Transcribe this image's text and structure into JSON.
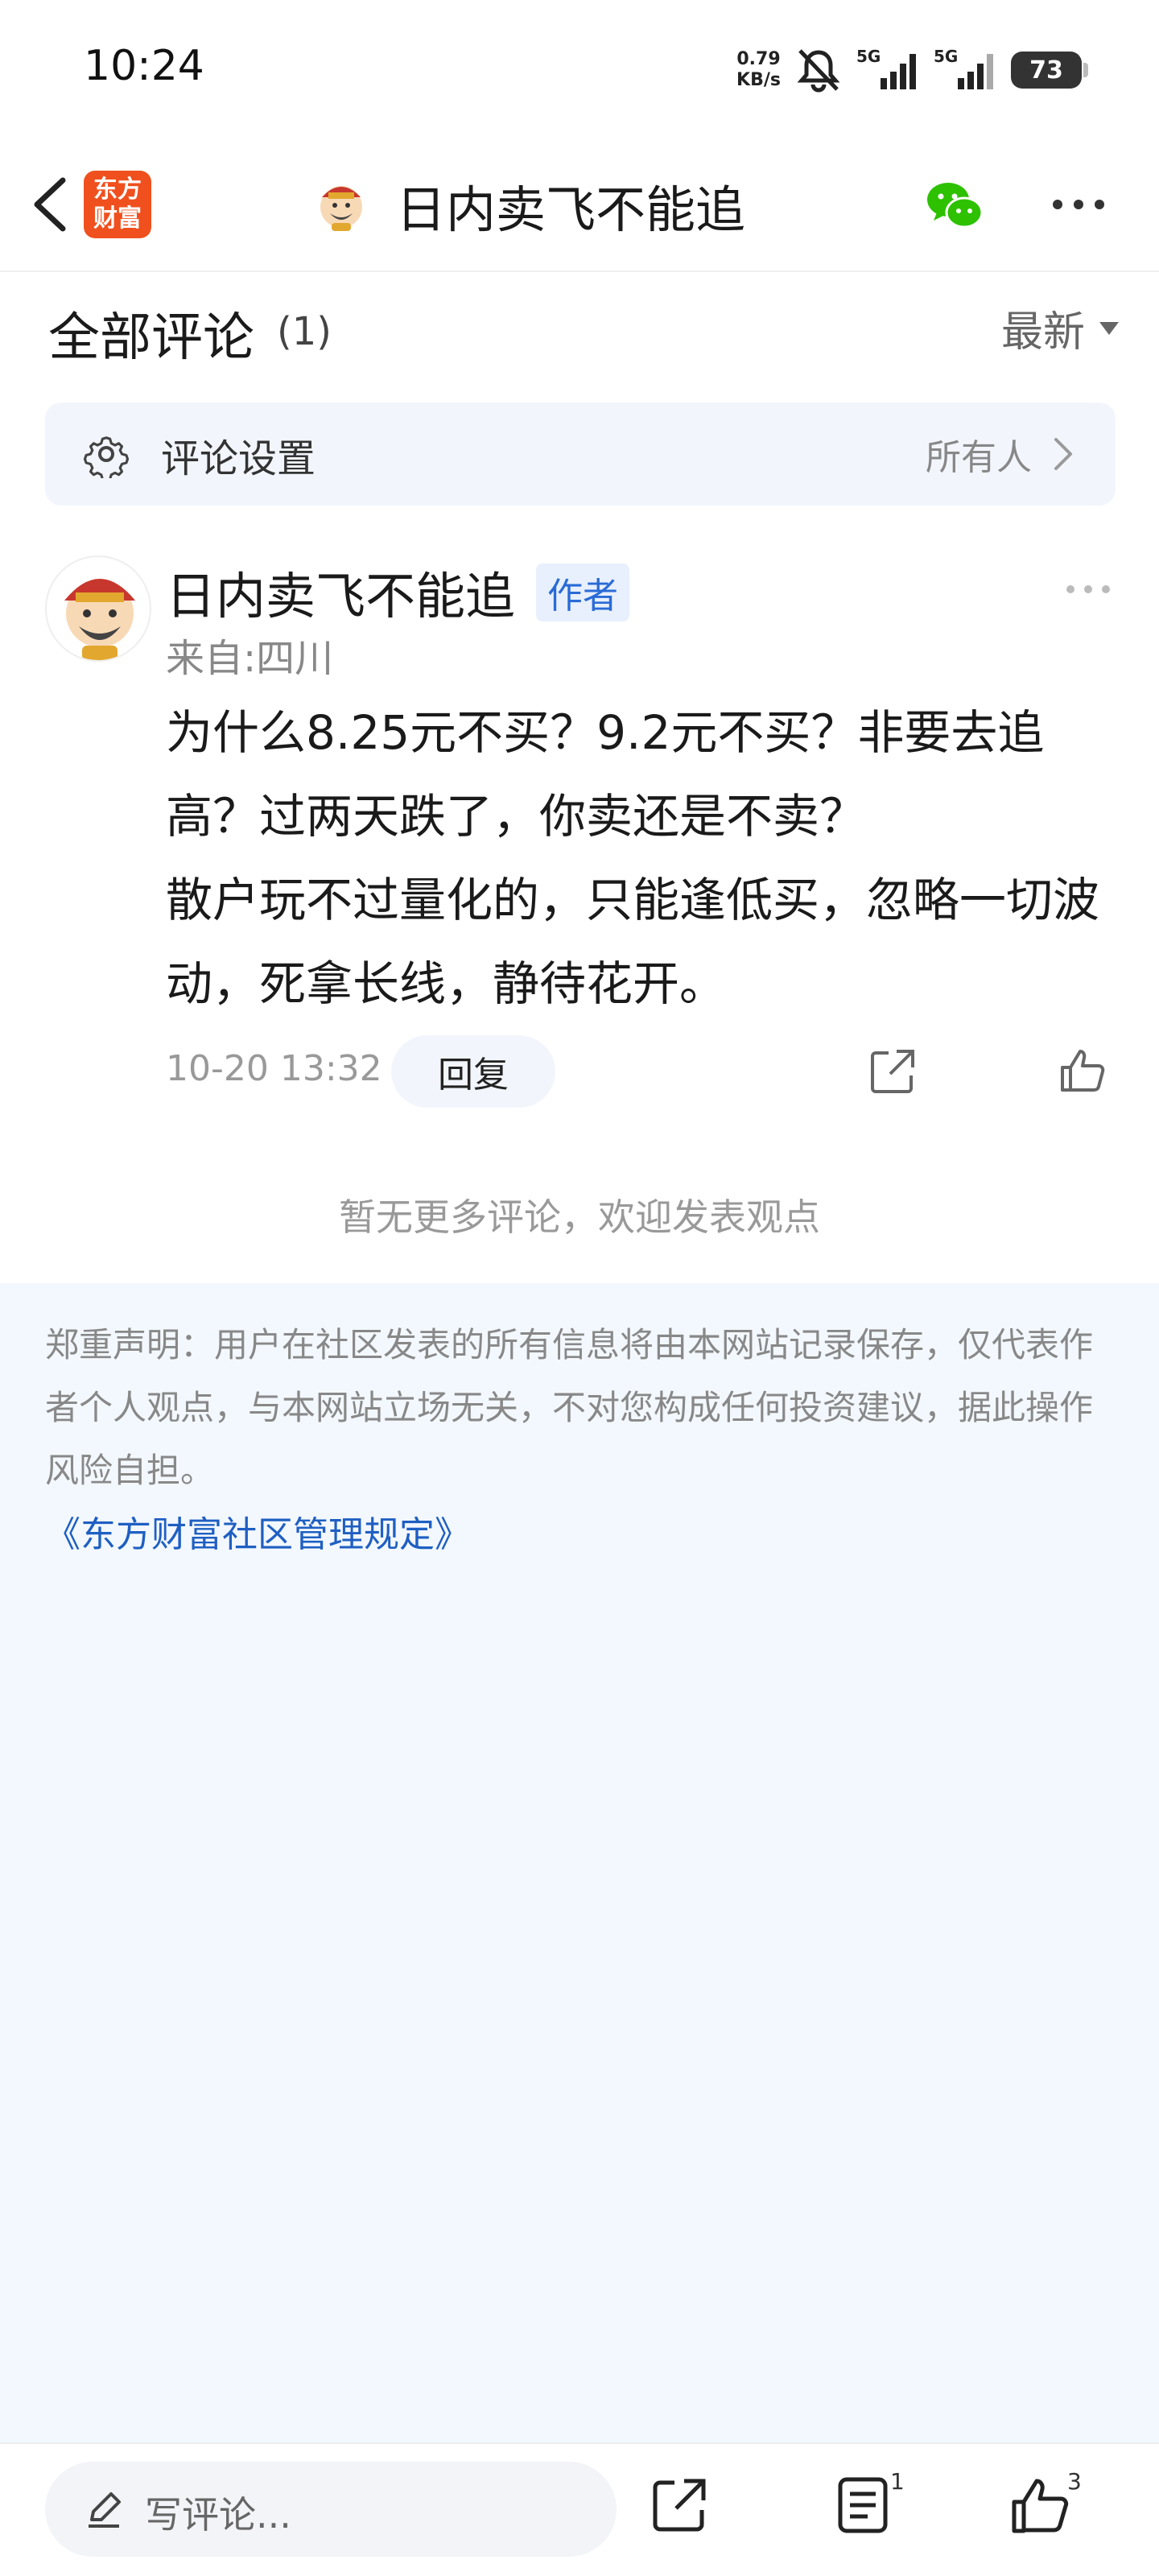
{
  "status_bar": {
    "time": "10:24",
    "net_speed_value": "0.79",
    "net_speed_unit": "KB/s",
    "signal_1": "5G",
    "signal_2": "5G",
    "battery": "73"
  },
  "nav": {
    "logo_line1": "东方",
    "logo_line2": "财富",
    "title": "日内卖飞不能追"
  },
  "comments": {
    "title": "全部评论",
    "count": "(1)",
    "sort": "最新"
  },
  "settings": {
    "label": "评论设置",
    "value": "所有人"
  },
  "comment": {
    "author": "日内卖飞不能追",
    "tag": "作者",
    "from": "来自:四川",
    "body_line1": "为什么8.25元不买？9.2元不买？非要去追高？过两天跌了，你卖还是不卖？",
    "body_line2": "散户玩不过量化的，只能逢低买，忽略一切波动，死拿长线，静待花开。",
    "time": "10-20 13:32",
    "reply": "回复"
  },
  "no_more": "暂无更多评论，欢迎发表观点",
  "disclaimer": {
    "text": "郑重声明：用户在社区发表的所有信息将由本网站记录保存，仅代表作者个人观点，与本网站立场无关，不对您构成任何投资建议，据此操作风险自担。",
    "link": "《东方财富社区管理规定》"
  },
  "bottom_bar": {
    "placeholder": "写评论...",
    "list_badge": "1",
    "like_badge": "3"
  },
  "colors": {
    "brand_orange": "#f0501e",
    "link_blue": "#1f5fc2",
    "tag_blue": "#2a6bd6",
    "wechat_green": "#2dc100",
    "panel_bg": "#f3f8fe"
  }
}
